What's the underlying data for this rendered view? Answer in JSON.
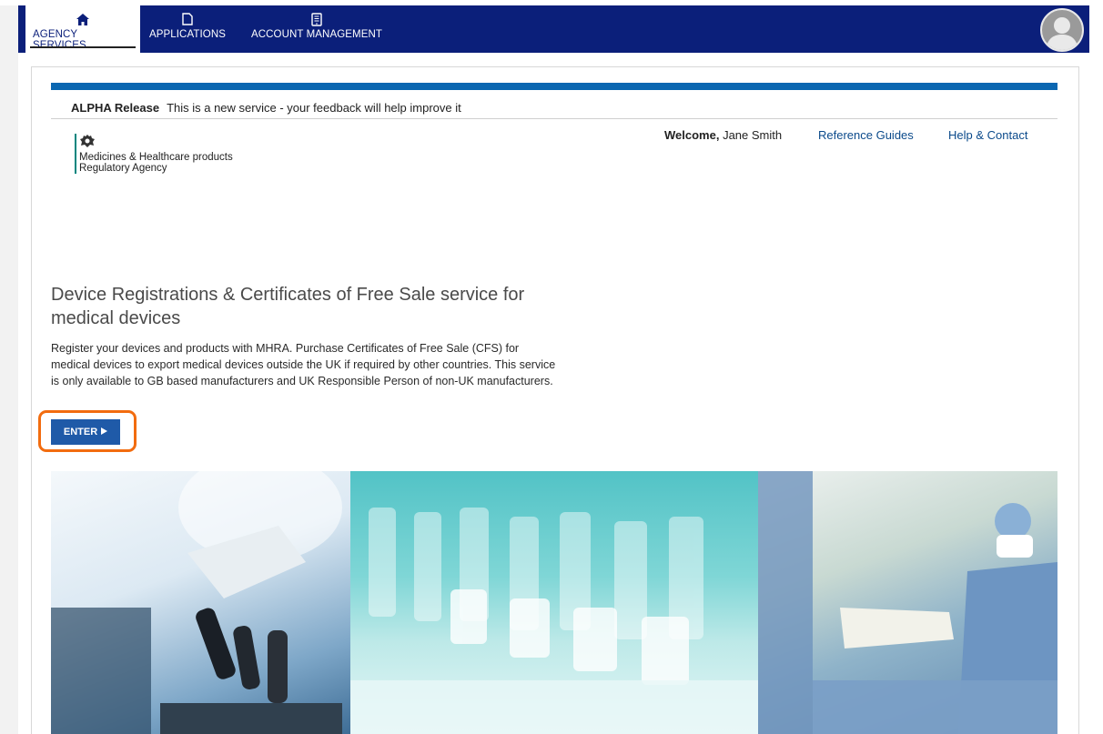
{
  "nav": {
    "tabs": [
      {
        "label": "AGENCY SERVICES",
        "icon": "home-icon",
        "active": true
      },
      {
        "label": "APPLICATIONS",
        "icon": "document-icon",
        "active": false
      },
      {
        "label": "ACCOUNT MANAGEMENT",
        "icon": "tablet-icon",
        "active": false
      }
    ],
    "avatar_icon": "user-avatar-icon"
  },
  "banner": {
    "label": "ALPHA Release",
    "text": "This is a new service - your feedback will help improve it"
  },
  "logo": {
    "line1": "Medicines & Healthcare products",
    "line2": "Regulatory Agency"
  },
  "header": {
    "welcome_label": "Welcome,",
    "user_name": "Jane Smith",
    "reference_guides": "Reference Guides",
    "help_contact": "Help & Contact"
  },
  "main": {
    "title": "Device Registrations & Certificates of Free Sale service for medical devices",
    "description": "Register your devices and products with MHRA. Purchase Certificates of Free Sale (CFS) for medical devices to export medical devices outside the UK if required by other countries. This service is only available to GB based manufacturers and UK Responsible Person of non-UK manufacturers.",
    "enter_label": "ENTER"
  },
  "colors": {
    "nav_bg": "#0b1f7a",
    "accent_blue": "#0b67b1",
    "button_blue": "#1f5aa8",
    "highlight": "#f26c0f",
    "logo_rule": "#00857e"
  }
}
